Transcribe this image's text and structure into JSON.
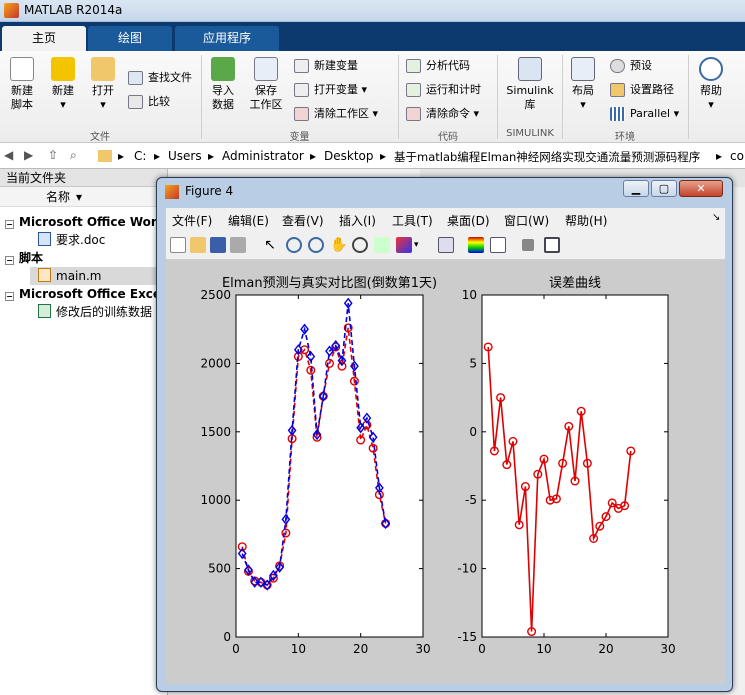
{
  "app": {
    "title": "MATLAB R2014a"
  },
  "tabs": [
    "主页",
    "绘图",
    "应用程序"
  ],
  "ribbon": {
    "file": {
      "new_script": "新建\n脚本",
      "new": "新建",
      "open": "打开",
      "find_files": "查找文件",
      "compare": "比较",
      "group": "文件"
    },
    "variable": {
      "import": "导入\n数据",
      "save_ws": "保存\n工作区",
      "new_var": "新建变量",
      "open_var": "打开变量",
      "clear_ws": "清除工作区",
      "group": "变量"
    },
    "code": {
      "analyze": "分析代码",
      "run_time": "运行和计时",
      "clear_cmds": "清除命令",
      "group": "代码"
    },
    "simulink": {
      "lib": "Simulink\n库",
      "group": "SIMULINK"
    },
    "env": {
      "layout": "布局",
      "prefs": "预设",
      "set_path": "设置路径",
      "parallel": "Parallel",
      "group": "环境"
    },
    "resources": {
      "help": "帮助"
    }
  },
  "address": {
    "crumbs": [
      "C:",
      "Users",
      "Administrator",
      "Desktop",
      "基于matlab编程Elman神经网络实现交通流量预测源码程序",
      "co"
    ]
  },
  "file_panel": {
    "title": "当前文件夹",
    "col_name": "名称",
    "rows": [
      {
        "type": "group",
        "label": "Microsoft Office Word"
      },
      {
        "type": "file",
        "label": "要求.doc",
        "icon": "word-doc-icon"
      },
      {
        "type": "group",
        "label": "脚本"
      },
      {
        "type": "file",
        "label": "main.m",
        "icon": "m-script-icon"
      },
      {
        "type": "group",
        "label": "Microsoft Office Excel"
      },
      {
        "type": "file",
        "label": "修改后的训练数据",
        "icon": "excel-icon"
      }
    ]
  },
  "figure": {
    "title": "Figure 4",
    "menu": [
      "文件(F)",
      "编辑(E)",
      "查看(V)",
      "插入(I)",
      "工具(T)",
      "桌面(D)",
      "窗口(W)",
      "帮助(H)"
    ]
  },
  "chart_data": [
    {
      "type": "line",
      "title": "Elman预测与真实对比图(倒数第1天)",
      "xlim": [
        0,
        30
      ],
      "ylim": [
        0,
        2500
      ],
      "xticks": [
        0,
        10,
        20,
        30
      ],
      "yticks": [
        0,
        500,
        1000,
        1500,
        2000,
        2500
      ],
      "series": [
        {
          "color": "#e00000",
          "marker": "circle",
          "style": "dashed",
          "x": [
            1,
            2,
            3,
            4,
            5,
            6,
            7,
            8,
            9,
            10,
            11,
            12,
            13,
            14,
            15,
            16,
            17,
            18,
            19,
            20,
            21,
            22,
            23,
            24
          ],
          "y": [
            660,
            480,
            410,
            400,
            380,
            430,
            520,
            760,
            1450,
            2050,
            2100,
            1950,
            1460,
            1760,
            2000,
            2120,
            1980,
            2260,
            1870,
            1440,
            1550,
            1380,
            1040,
            830
          ]
        },
        {
          "color": "#0000e0",
          "marker": "diamond",
          "style": "dashed",
          "x": [
            1,
            2,
            3,
            4,
            5,
            6,
            7,
            8,
            9,
            10,
            11,
            12,
            13,
            14,
            15,
            16,
            17,
            18,
            19,
            20,
            21,
            22,
            23,
            24
          ],
          "y": [
            610,
            490,
            400,
            400,
            380,
            450,
            510,
            860,
            1510,
            2100,
            2250,
            2050,
            1480,
            1760,
            2090,
            2130,
            2020,
            2440,
            1980,
            1530,
            1600,
            1460,
            1090,
            830
          ]
        }
      ]
    },
    {
      "type": "line",
      "title": "误差曲线",
      "xlim": [
        0,
        30
      ],
      "ylim": [
        -15,
        10
      ],
      "xticks": [
        0,
        10,
        20,
        30
      ],
      "yticks": [
        -15,
        -10,
        -5,
        0,
        5,
        10
      ],
      "series": [
        {
          "color": "#e00000",
          "marker": "circle",
          "style": "solid",
          "x": [
            1,
            2,
            3,
            4,
            5,
            6,
            7,
            8,
            9,
            10,
            11,
            12,
            13,
            14,
            15,
            16,
            17,
            18,
            19,
            20,
            21,
            22,
            23,
            24
          ],
          "y": [
            6.2,
            -1.4,
            2.5,
            -2.4,
            -0.7,
            -6.8,
            -4.0,
            -14.6,
            -3.1,
            -2.0,
            -5.0,
            -4.9,
            -2.3,
            0.4,
            -3.6,
            1.5,
            -2.3,
            -7.8,
            -6.9,
            -6.2,
            -5.2,
            -5.6,
            -5.4,
            -1.4
          ]
        }
      ]
    }
  ]
}
